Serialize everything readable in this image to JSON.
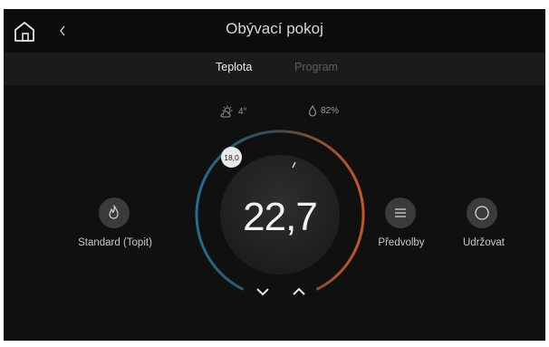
{
  "header": {
    "title": "Obývací pokoj"
  },
  "tabs": [
    {
      "label": "Teplota",
      "active": true
    },
    {
      "label": "Program",
      "active": false
    }
  ],
  "status": {
    "outdoor_temp": "4°",
    "humidity": "82%"
  },
  "thermostat": {
    "current_temp": "22,7",
    "setpoint": "18,0",
    "arc_colors": {
      "cold": "#1f6f92",
      "warm": "#c9552a"
    }
  },
  "modes": {
    "heat_label": "Standard (Topit)",
    "presets_label": "Předvolby",
    "hold_label": "Udržovat"
  },
  "icons": {
    "home": "home-icon",
    "back": "chevron-left-icon",
    "weather": "sun-cloud-icon",
    "humidity": "droplet-icon",
    "heat": "flame-icon",
    "presets": "menu-lines-icon",
    "hold": "circle-icon",
    "down": "chevron-down-icon",
    "up": "chevron-up-icon"
  }
}
